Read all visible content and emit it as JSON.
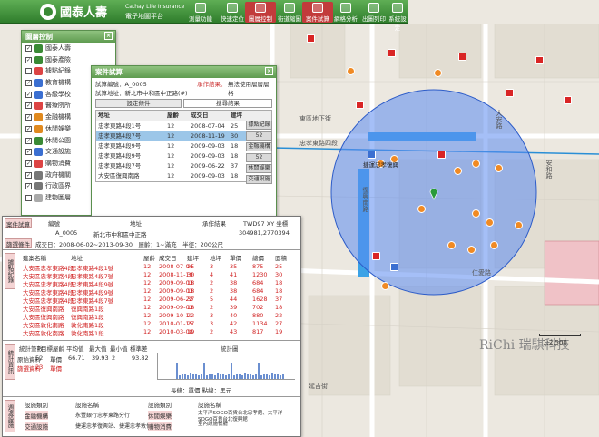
{
  "app": {
    "brand_cn": "國泰人壽",
    "brand_en": "Cathay Life Insurance",
    "subtitle": "電子地圖平台"
  },
  "toolbar": [
    {
      "label": "測量功能"
    },
    {
      "label": "快速定位"
    },
    {
      "label": "圖層控制",
      "active": true
    },
    {
      "label": "街道縮圖"
    },
    {
      "label": "案件試算"
    },
    {
      "label": "網格分析"
    },
    {
      "label": "出圖列印"
    },
    {
      "label": "系統設定"
    }
  ],
  "layer_panel": {
    "title": "圖層控制",
    "items": [
      {
        "label": "國泰人壽",
        "checked": true,
        "color": "#3a8a35"
      },
      {
        "label": "國泰產險",
        "checked": true,
        "color": "#3a8a35"
      },
      {
        "label": "據點紀錄",
        "checked": false,
        "color": "#d44"
      },
      {
        "label": "教育機構",
        "checked": true,
        "color": "#3b6fd1"
      },
      {
        "label": "各級學校",
        "checked": true,
        "color": "#3b6fd1"
      },
      {
        "label": "醫療院所",
        "checked": true,
        "color": "#d44"
      },
      {
        "label": "金融機構",
        "checked": true,
        "color": "#e08a20"
      },
      {
        "label": "休閒娛樂",
        "checked": true,
        "color": "#e08a20"
      },
      {
        "label": "休閒公園",
        "checked": true,
        "color": "#3a8a35"
      },
      {
        "label": "交通設施",
        "checked": true,
        "color": "#3b6fd1"
      },
      {
        "label": "購物消費",
        "checked": true,
        "color": "#d44"
      },
      {
        "label": "政府機關",
        "checked": true,
        "color": "#777"
      },
      {
        "label": "行政區界",
        "checked": true,
        "color": "#777"
      },
      {
        "label": "建物圖層",
        "checked": false,
        "color": "#aaa"
      }
    ]
  },
  "case_panel": {
    "title": "案件試算",
    "case_no_label": "試算編號：",
    "case_no": "A_0005",
    "status_label": "承作結果：",
    "status": "無法使用層層層格",
    "addr_label": "試算地址：",
    "addr": "新北市中和區中正路(#)",
    "tab1": "設定條件",
    "tab2": "搜尋結果",
    "cols": [
      "地址",
      "屋齡",
      "成交日",
      "建坪"
    ],
    "rows": [
      {
        "addr": "忠孝東路4段1号",
        "age": "12",
        "date": "2008-07-04",
        "area": "25"
      },
      {
        "addr": "忠孝東路4段7号",
        "age": "12",
        "date": "2008-11-19",
        "area": "30"
      },
      {
        "addr": "忠孝東路4段9号",
        "age": "12",
        "date": "2009-09-03",
        "area": "18"
      },
      {
        "addr": "忠孝東路4段9号",
        "age": "12",
        "date": "2009-09-03",
        "area": "18"
      },
      {
        "addr": "忠孝東路4段7号",
        "age": "12",
        "date": "2009-06-22",
        "area": "37"
      },
      {
        "addr": "大安區復興南路",
        "age": "12",
        "date": "2009-09-03",
        "area": "18"
      }
    ],
    "buttons": [
      "據點紀錄",
      "52",
      "金融機構",
      "52",
      "休閒娛樂",
      "交通設施"
    ]
  },
  "report": {
    "header": {
      "case_label": "案件試算",
      "cols": [
        "編號",
        "地址",
        "承作結果",
        "TWD97 XY 坐標"
      ],
      "values": [
        "A_0005",
        "新北市中和區中正路",
        "",
        "304981,2770394"
      ]
    },
    "cond_label": "篩選條件",
    "cond_text": "成交日：2008-06-02~2013-09-30　屋齡：1~滿充　半徑：200公尺",
    "records_label": "據點紀錄",
    "rec_cols": [
      "建案名稱",
      "地址",
      "屋齡",
      "成交日",
      "建坪",
      "地坪",
      "單價",
      "總價",
      "面積"
    ],
    "rec_rows": [
      [
        "大安區忠孝東路4段",
        "忠孝東路4段1號",
        "12",
        "2008-07-04",
        "25",
        "3",
        "35",
        "875",
        "25"
      ],
      [
        "大安區忠孝東路4段",
        "忠孝東路4段7號",
        "12",
        "2008-11-19",
        "30",
        "4",
        "41",
        "1230",
        "30"
      ],
      [
        "大安區忠孝東路4段",
        "忠孝東路4段9號",
        "12",
        "2009-09-03",
        "18",
        "2",
        "38",
        "684",
        "18"
      ],
      [
        "大安區忠孝東路4段",
        "忠孝東路4段9號",
        "12",
        "2009-09-03",
        "18",
        "2",
        "38",
        "684",
        "18"
      ],
      [
        "大安區忠孝東路4段",
        "忠孝東路4段7號",
        "12",
        "2009-06-22",
        "37",
        "5",
        "44",
        "1628",
        "37"
      ],
      [
        "大安區復興南路",
        "復興南路1段",
        "12",
        "2009-09-03",
        "18",
        "2",
        "39",
        "702",
        "18"
      ],
      [
        "大安區復興南路",
        "復興南路1段",
        "12",
        "2009-10-11",
        "22",
        "3",
        "40",
        "880",
        "22"
      ],
      [
        "大安區敦化南路",
        "敦化南路1段",
        "12",
        "2010-01-15",
        "27",
        "3",
        "42",
        "1134",
        "27"
      ],
      [
        "大安區敦化南路",
        "敦化南路1段",
        "12",
        "2010-03-08",
        "19",
        "2",
        "43",
        "817",
        "19"
      ]
    ],
    "stat_label": "統計資訊",
    "stat_cols": [
      "統計筆數",
      "目標屋齡",
      "平均值",
      "最大值",
      "最小值",
      "標準差",
      "統計圖"
    ],
    "stat_rows": [
      [
        "原始資料",
        "52",
        "單價",
        "66.71",
        "39.93",
        "2",
        "93.82"
      ],
      [
        "篩選資料",
        "23",
        "單價",
        "",
        "",
        "",
        ""
      ]
    ],
    "stat_legend": "長條：單價  點線：黑元",
    "around_label": "週邊設施",
    "around_cols": [
      "設施類別",
      "設施名稱",
      "設施類別",
      "設施名稱"
    ],
    "around_rows": [
      [
        "金融機構",
        "永豐銀行忠孝東路分行",
        "休閒娛樂",
        "太平洋SOGO百貨台北忠孝館、太平洋SOGO百貨台北復興館"
      ],
      [
        "交通設施",
        "捷運忠孝復興站、捷運忠孝敦化站",
        "購物消費",
        "室內設施餐廳"
      ]
    ]
  },
  "map": {
    "streets": [
      "忠孝東路四段",
      "復興南路",
      "安和路",
      "大安路",
      "仁愛路",
      "延吉街",
      "東區地下街"
    ],
    "station": "捷運忠孝復興",
    "scale": "1:2,500",
    "brand": "RiChi 瑞騏科技"
  }
}
